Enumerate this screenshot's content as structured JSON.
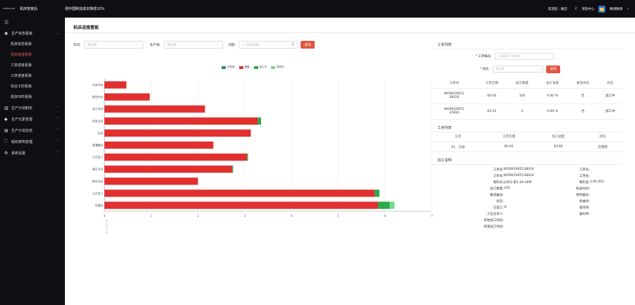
{
  "topbar": {
    "logo": "OPERATION",
    "app_title": "机床管家后",
    "slogan": "把中国制造成本降低10%",
    "welcome": "欢迎您 · 离店：",
    "notification": "消息中心",
    "user": "数调数调"
  },
  "sidebar": {
    "groups": [
      {
        "icon": "◎",
        "label": "生产状态看板",
        "items": [
          "机床状态看板",
          "机床进度看板",
          "工单进度看板",
          "工序进度看板",
          "综合工时看板",
          "机床OEE看板"
        ]
      },
      {
        "icon": "▥",
        "label": "生产计划制定",
        "items": []
      },
      {
        "icon": "⚙",
        "label": "生产元素管理",
        "items": []
      },
      {
        "icon": "▤",
        "label": "生产计划总结",
        "items": []
      },
      {
        "icon": "⛶",
        "label": "组织架构管理",
        "items": []
      },
      {
        "icon": "⚙",
        "label": "系统设置",
        "items": []
      }
    ],
    "active_item": "机床进度看板",
    "colors": {
      "bg": "#0e0f13",
      "active": "#e4584a"
    }
  },
  "page": {
    "title": "机床进度看板"
  },
  "filters": {
    "workshop_label": "车间:",
    "workshop_placeholder": "请选择",
    "line_label": "生产线:",
    "line_placeholder": "请选择",
    "date_label": "日期:",
    "date_placeholder": "选择日期",
    "query_label": "查询"
  },
  "chart_data": {
    "type": "bar",
    "orientation": "horizontal",
    "stacked": true,
    "legend": [
      "已完成",
      "报废",
      "加工中",
      "排多中"
    ],
    "legend_colors": [
      "#1b8c80",
      "#e03030",
      "#2ea84a",
      "#6fdc88"
    ],
    "categories": [
      "车圆床",
      "立式加工",
      "数车车床",
      "盒车车床",
      "立式加工",
      "普通磨床",
      "车床",
      "排多车床",
      "加工车床",
      "数控车床",
      "车床车床"
    ],
    "series": [
      {
        "name": "报废",
        "values": [
          5.85,
          5.78,
          2.0,
          2.73,
          3.05,
          2.33,
          3.13,
          3.28,
          2.15,
          0.97,
          0.47
        ]
      },
      {
        "name": "加工中",
        "values": [
          0.25,
          0.1,
          0,
          0.02,
          0.02,
          0,
          0,
          0.07,
          0,
          0,
          0
        ]
      },
      {
        "name": "排多中",
        "values": [
          0.1,
          0,
          0,
          0,
          0,
          0,
          0,
          0,
          0,
          0,
          0
        ]
      }
    ],
    "xlim": [
      0,
      7
    ],
    "x_ticks": [
      "0",
      "1",
      "2",
      "3",
      "4",
      "5",
      "6",
      "7"
    ],
    "x_first_tick_note": "0 0 0 0 0 0"
  },
  "right": {
    "work_list_title": "工单列表",
    "work_order_label": "* 工单编号:",
    "work_order_placeholder": "请选择工单/编号",
    "status_label": "* 状态:",
    "status_placeholder": "请选择",
    "query_label": "查询",
    "order_table": {
      "headers": [
        "工单号",
        "工单交期",
        "加工数量",
        "加工进度",
        "紧急状态",
        "状态"
      ],
      "rows": [
        [
          "WORK19051\n38024",
          "06-03",
          "100",
          "0.00 %",
          "否",
          "加工中"
        ],
        [
          "WORK19051\n37816",
          "05-31",
          "2",
          "0.00 %",
          "否",
          "加工中"
        ]
      ]
    },
    "process_list_title": "工序列表",
    "process_table": {
      "headers": [
        "工序",
        "工序交期",
        "加工进度",
        "状态"
      ],
      "rows": [
        [
          "A1 · 工站",
          "06-03",
          "0/100",
          "已完结"
        ]
      ]
    },
    "detail_title": "加工说明",
    "detail": [
      [
        "工单号:",
        "WORK1905138024",
        "工序号:",
        ""
      ],
      [
        "订单号:",
        "WORK1905138024",
        "工序名:",
        ""
      ],
      [
        "物料号:",
        "JGB7J 第1.29.38件",
        "物料名:",
        "3.06.003"
      ],
      [
        "加工数量:",
        "100",
        "机床时间:",
        ""
      ],
      [
        "模具编号:",
        "",
        "原料编号:",
        ""
      ],
      [
        "状态:",
        "",
        "机械师:",
        ""
      ],
      [
        "已加工:",
        "%",
        "操作师:",
        ""
      ],
      [
        "工位负责人:",
        "",
        "备料师:",
        ""
      ],
      [
        "开始加工时间:",
        "",
        "",
        ""
      ],
      [
        "结束加工时间:",
        "",
        "",
        ""
      ]
    ]
  }
}
